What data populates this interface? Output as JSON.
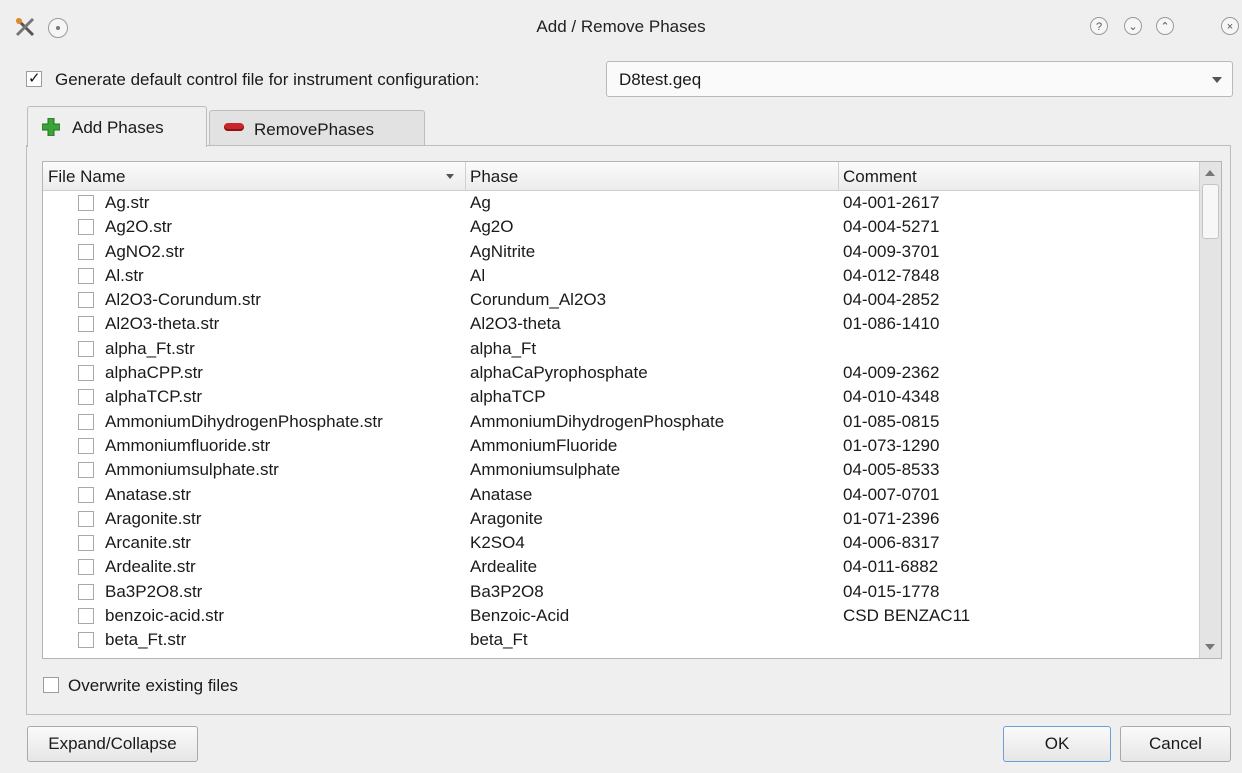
{
  "window": {
    "title": "Add / Remove Phases",
    "buttons": {
      "help": "?",
      "minimize": "⌄",
      "maximize": "⌃",
      "close": "×"
    }
  },
  "generate": {
    "checked": true,
    "label": "Generate default control file for instrument configuration:",
    "instrument_value": "D8test.geq"
  },
  "tabs": [
    {
      "label": "Add Phases",
      "icon": "green-plus-icon",
      "active": true
    },
    {
      "label": "RemovePhases",
      "icon": "red-minus-icon",
      "active": false
    }
  ],
  "table": {
    "headers": [
      "File Name",
      "Phase",
      "Comment"
    ],
    "rows": [
      [
        "Ag.str",
        "Ag",
        "04-001-2617"
      ],
      [
        "Ag2O.str",
        "Ag2O",
        "04-004-5271"
      ],
      [
        "AgNO2.str",
        "AgNitrite",
        "04-009-3701"
      ],
      [
        "Al.str",
        "Al",
        "04-012-7848"
      ],
      [
        "Al2O3-Corundum.str",
        "Corundum_Al2O3",
        "04-004-2852"
      ],
      [
        "Al2O3-theta.str",
        "Al2O3-theta",
        "01-086-1410"
      ],
      [
        "alpha_Ft.str",
        "alpha_Ft",
        ""
      ],
      [
        "alphaCPP.str",
        "alphaCaPyrophosphate",
        "04-009-2362"
      ],
      [
        "alphaTCP.str",
        "alphaTCP",
        "04-010-4348"
      ],
      [
        "AmmoniumDihydrogenPhosphate.str",
        "AmmoniumDihydrogenPhosphate",
        "01-085-0815"
      ],
      [
        "Ammoniumfluoride.str",
        "AmmoniumFluoride",
        "01-073-1290"
      ],
      [
        "Ammoniumsulphate.str",
        "Ammoniumsulphate",
        "04-005-8533"
      ],
      [
        "Anatase.str",
        "Anatase",
        "04-007-0701"
      ],
      [
        "Aragonite.str",
        "Aragonite",
        "01-071-2396"
      ],
      [
        "Arcanite.str",
        "K2SO4",
        "04-006-8317"
      ],
      [
        "Ardealite.str",
        "Ardealite",
        "04-011-6882"
      ],
      [
        "Ba3P2O8.str",
        "Ba3P2O8",
        "04-015-1778"
      ],
      [
        "benzoic-acid.str",
        "Benzoic-Acid",
        "CSD BENZAC11"
      ],
      [
        "beta_Ft.str",
        "beta_Ft",
        ""
      ]
    ]
  },
  "overwrite": {
    "checked": false,
    "label": "Overwrite existing files"
  },
  "buttons": {
    "expand": "Expand/Collapse",
    "ok": "OK",
    "cancel": "Cancel"
  }
}
